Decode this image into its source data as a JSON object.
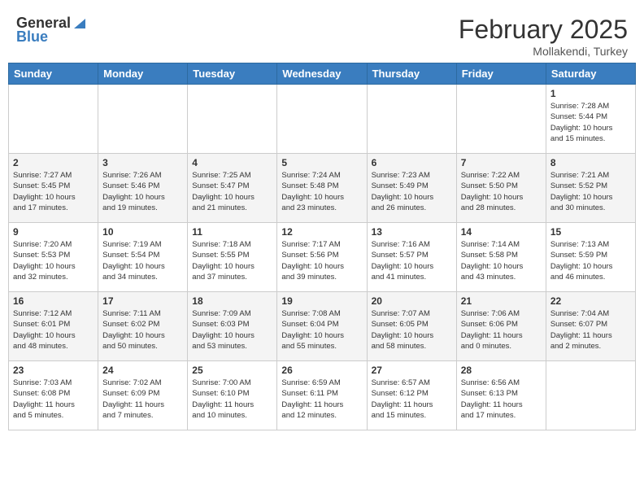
{
  "header": {
    "logo_general": "General",
    "logo_blue": "Blue",
    "month_title": "February 2025",
    "location": "Mollakendi, Turkey"
  },
  "calendar": {
    "days_of_week": [
      "Sunday",
      "Monday",
      "Tuesday",
      "Wednesday",
      "Thursday",
      "Friday",
      "Saturday"
    ],
    "weeks": [
      [
        {
          "day": "",
          "info": ""
        },
        {
          "day": "",
          "info": ""
        },
        {
          "day": "",
          "info": ""
        },
        {
          "day": "",
          "info": ""
        },
        {
          "day": "",
          "info": ""
        },
        {
          "day": "",
          "info": ""
        },
        {
          "day": "1",
          "info": "Sunrise: 7:28 AM\nSunset: 5:44 PM\nDaylight: 10 hours\nand 15 minutes."
        }
      ],
      [
        {
          "day": "2",
          "info": "Sunrise: 7:27 AM\nSunset: 5:45 PM\nDaylight: 10 hours\nand 17 minutes."
        },
        {
          "day": "3",
          "info": "Sunrise: 7:26 AM\nSunset: 5:46 PM\nDaylight: 10 hours\nand 19 minutes."
        },
        {
          "day": "4",
          "info": "Sunrise: 7:25 AM\nSunset: 5:47 PM\nDaylight: 10 hours\nand 21 minutes."
        },
        {
          "day": "5",
          "info": "Sunrise: 7:24 AM\nSunset: 5:48 PM\nDaylight: 10 hours\nand 23 minutes."
        },
        {
          "day": "6",
          "info": "Sunrise: 7:23 AM\nSunset: 5:49 PM\nDaylight: 10 hours\nand 26 minutes."
        },
        {
          "day": "7",
          "info": "Sunrise: 7:22 AM\nSunset: 5:50 PM\nDaylight: 10 hours\nand 28 minutes."
        },
        {
          "day": "8",
          "info": "Sunrise: 7:21 AM\nSunset: 5:52 PM\nDaylight: 10 hours\nand 30 minutes."
        }
      ],
      [
        {
          "day": "9",
          "info": "Sunrise: 7:20 AM\nSunset: 5:53 PM\nDaylight: 10 hours\nand 32 minutes."
        },
        {
          "day": "10",
          "info": "Sunrise: 7:19 AM\nSunset: 5:54 PM\nDaylight: 10 hours\nand 34 minutes."
        },
        {
          "day": "11",
          "info": "Sunrise: 7:18 AM\nSunset: 5:55 PM\nDaylight: 10 hours\nand 37 minutes."
        },
        {
          "day": "12",
          "info": "Sunrise: 7:17 AM\nSunset: 5:56 PM\nDaylight: 10 hours\nand 39 minutes."
        },
        {
          "day": "13",
          "info": "Sunrise: 7:16 AM\nSunset: 5:57 PM\nDaylight: 10 hours\nand 41 minutes."
        },
        {
          "day": "14",
          "info": "Sunrise: 7:14 AM\nSunset: 5:58 PM\nDaylight: 10 hours\nand 43 minutes."
        },
        {
          "day": "15",
          "info": "Sunrise: 7:13 AM\nSunset: 5:59 PM\nDaylight: 10 hours\nand 46 minutes."
        }
      ],
      [
        {
          "day": "16",
          "info": "Sunrise: 7:12 AM\nSunset: 6:01 PM\nDaylight: 10 hours\nand 48 minutes."
        },
        {
          "day": "17",
          "info": "Sunrise: 7:11 AM\nSunset: 6:02 PM\nDaylight: 10 hours\nand 50 minutes."
        },
        {
          "day": "18",
          "info": "Sunrise: 7:09 AM\nSunset: 6:03 PM\nDaylight: 10 hours\nand 53 minutes."
        },
        {
          "day": "19",
          "info": "Sunrise: 7:08 AM\nSunset: 6:04 PM\nDaylight: 10 hours\nand 55 minutes."
        },
        {
          "day": "20",
          "info": "Sunrise: 7:07 AM\nSunset: 6:05 PM\nDaylight: 10 hours\nand 58 minutes."
        },
        {
          "day": "21",
          "info": "Sunrise: 7:06 AM\nSunset: 6:06 PM\nDaylight: 11 hours\nand 0 minutes."
        },
        {
          "day": "22",
          "info": "Sunrise: 7:04 AM\nSunset: 6:07 PM\nDaylight: 11 hours\nand 2 minutes."
        }
      ],
      [
        {
          "day": "23",
          "info": "Sunrise: 7:03 AM\nSunset: 6:08 PM\nDaylight: 11 hours\nand 5 minutes."
        },
        {
          "day": "24",
          "info": "Sunrise: 7:02 AM\nSunset: 6:09 PM\nDaylight: 11 hours\nand 7 minutes."
        },
        {
          "day": "25",
          "info": "Sunrise: 7:00 AM\nSunset: 6:10 PM\nDaylight: 11 hours\nand 10 minutes."
        },
        {
          "day": "26",
          "info": "Sunrise: 6:59 AM\nSunset: 6:11 PM\nDaylight: 11 hours\nand 12 minutes."
        },
        {
          "day": "27",
          "info": "Sunrise: 6:57 AM\nSunset: 6:12 PM\nDaylight: 11 hours\nand 15 minutes."
        },
        {
          "day": "28",
          "info": "Sunrise: 6:56 AM\nSunset: 6:13 PM\nDaylight: 11 hours\nand 17 minutes."
        },
        {
          "day": "",
          "info": ""
        }
      ]
    ]
  }
}
